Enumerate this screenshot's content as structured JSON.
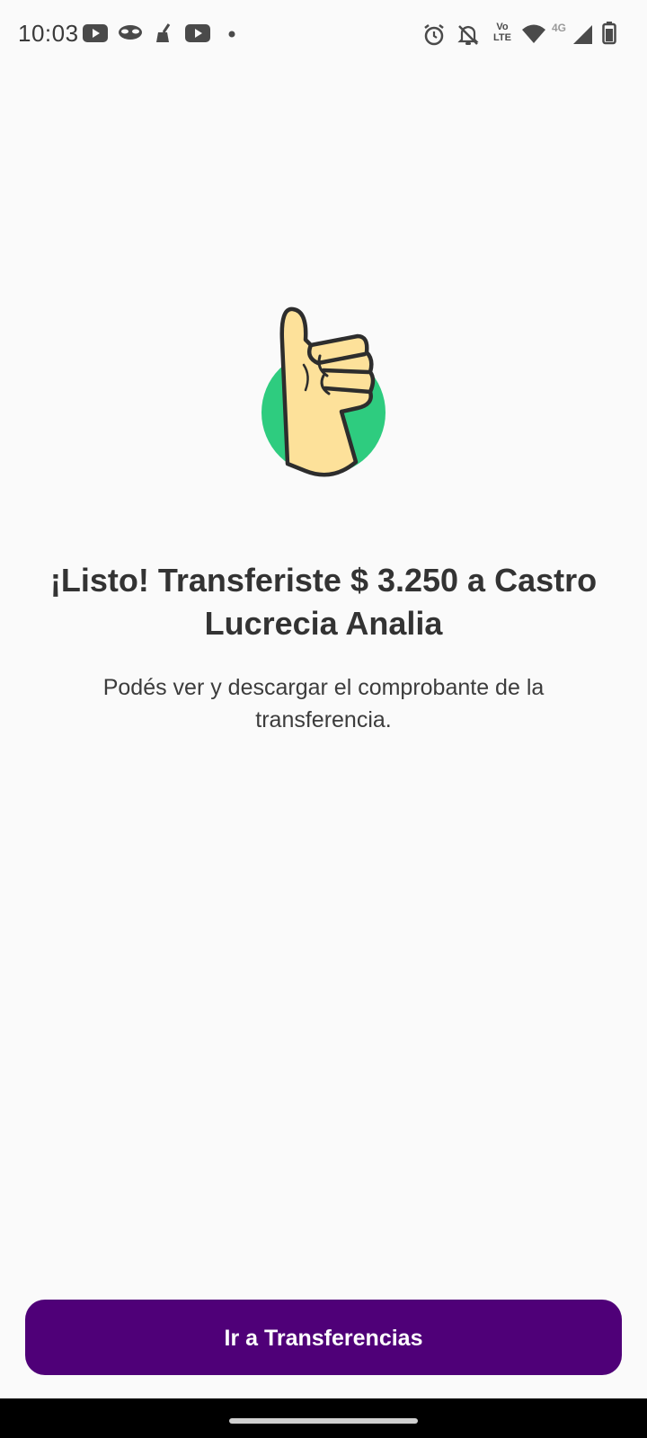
{
  "status_bar": {
    "time": "10:03",
    "network_label": "4G",
    "volte_top": "Vo",
    "volte_bottom": "LTE",
    "notification_icons": [
      "youtube-icon",
      "mask-icon",
      "broom-icon",
      "youtube-icon",
      "dot-icon"
    ],
    "system_icons": [
      "alarm-icon",
      "bell-off-icon",
      "volte-icon",
      "wifi-icon",
      "signal-icon",
      "battery-icon"
    ]
  },
  "illustration": {
    "icon": "thumbs-up-icon",
    "circle_color": "#2ecc7f",
    "hand_color": "#fde19a",
    "outline_color": "#2d2d2d"
  },
  "content": {
    "title": "¡Listo! Transferiste $ 3.250 a Castro Lucrecia Analia",
    "subtitle": "Podés ver y descargar el comprobante de la transferencia."
  },
  "actions": {
    "primary_label": "Ir a Transferencias",
    "primary_color": "#4f0078"
  }
}
